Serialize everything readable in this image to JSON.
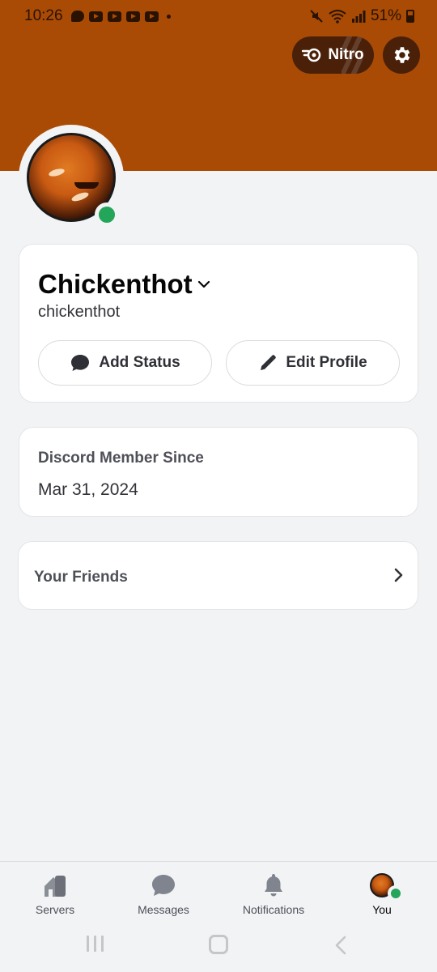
{
  "status_bar": {
    "time": "10:26",
    "battery": "51%"
  },
  "header": {
    "nitro_label": "Nitro",
    "settings_icon": "gear-icon",
    "banner_color": "#a94b05"
  },
  "profile": {
    "display_name": "Chickenthot",
    "username": "chickenthot",
    "presence": "online",
    "presence_color": "#23a55a",
    "add_status_label": "Add Status",
    "edit_profile_label": "Edit Profile"
  },
  "member_since": {
    "label": "Discord Member Since",
    "date": "Mar 31, 2024"
  },
  "friends": {
    "label": "Your Friends"
  },
  "bottom_nav": {
    "items": [
      {
        "label": "Servers",
        "icon": "servers-icon"
      },
      {
        "label": "Messages",
        "icon": "chat-bubble-icon"
      },
      {
        "label": "Notifications",
        "icon": "bell-icon"
      },
      {
        "label": "You",
        "icon": "avatar"
      }
    ],
    "active": "You"
  }
}
